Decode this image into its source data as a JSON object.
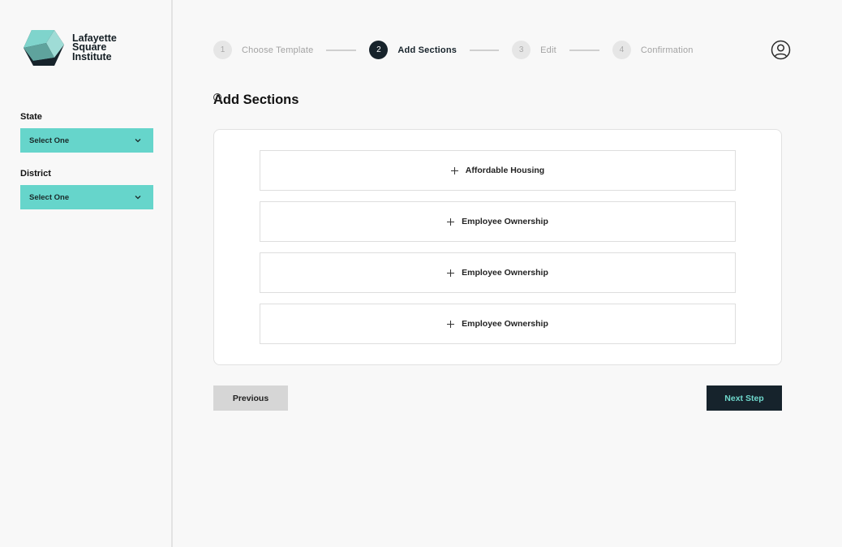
{
  "brand": {
    "line1": "Lafayette",
    "line2": "Square",
    "line3": "Institute"
  },
  "sidebar": {
    "state_label": "State",
    "state_value": "Select One",
    "district_label": "District",
    "district_value": "Select One"
  },
  "stepper": {
    "steps": [
      {
        "num": "1",
        "label": "Choose Template"
      },
      {
        "num": "2",
        "label": "Add Sections"
      },
      {
        "num": "3",
        "label": "Edit"
      },
      {
        "num": "4",
        "label": "Confirmation"
      }
    ],
    "active_step": 2
  },
  "main": {
    "title": "Add Sections",
    "sections": [
      {
        "label": "Affordable Housing"
      },
      {
        "label": "Employee Ownership"
      },
      {
        "label": "Employee Ownership"
      },
      {
        "label": "Employee Ownership"
      }
    ]
  },
  "nav": {
    "previous_label": "Previous",
    "next_label": "Next Step"
  },
  "colors": {
    "accent": "#66d5cb",
    "dark": "#16232c"
  }
}
